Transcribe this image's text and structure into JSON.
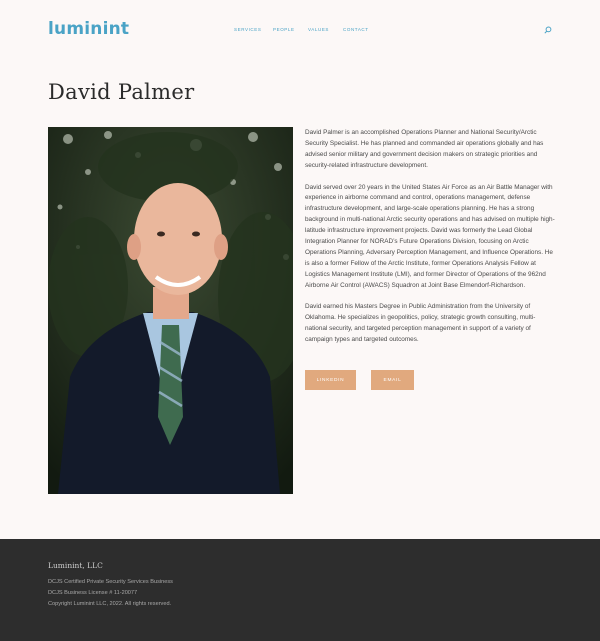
{
  "brand": {
    "name": "luminint",
    "color": "#4aa3c6"
  },
  "nav": {
    "items": [
      {
        "label": "SERVICES"
      },
      {
        "label": "PEOPLE"
      },
      {
        "label": "VALUES"
      },
      {
        "label": "CONTACT"
      }
    ],
    "search_icon": "search-icon"
  },
  "page": {
    "title": "David Palmer"
  },
  "photo": {
    "alt": "Portrait of David Palmer"
  },
  "bio": {
    "paragraphs": [
      "David Palmer is an accomplished Operations Planner and National Security/Arctic Security Specialist. He has planned and commanded air operations globally and has advised senior military and government decision makers on strategic priorities and security-related infrastructure development.",
      "David served over 20 years in the United States Air Force as an Air Battle Manager with experience in airborne command and control, operations management, defense infrastructure development, and large-scale operations planning. He has a strong background in multi-national Arctic security operations and has advised on multiple high-latitude infrastructure improvement projects. David was formerly the Lead Global Integration Planner for NORAD’s Future Operations Division, focusing on Arctic Operations Planning, Adversary Perception Management, and Influence Operations. He is also a former Fellow of the Arctic Institute, former Operations Analysis Fellow at Logistics Management Institute (LMI), and former Director of Operations of the 962nd Airborne Air Control (AWACS) Squadron at Joint Base Elmendorf-Richardson.",
      "David earned his Masters Degree in Public Administration from the University of Oklahoma. He specializes in geopolitics, policy, strategic growth consulting, multi-national security, and targeted perception management in support of a variety of campaign types and targeted outcomes."
    ]
  },
  "buttons": {
    "linkedin": "LINKEDIN",
    "email": "EMAIL",
    "color": "#e1a97e"
  },
  "footer": {
    "title": "Luminint, LLC",
    "lines": [
      "DCJS Certified Private Security Services Business",
      "DCJS Business License # 11-20077",
      "Copyright Luminint LLC, 2022.  All rights reserved."
    ],
    "background": "#2d2d2d"
  }
}
